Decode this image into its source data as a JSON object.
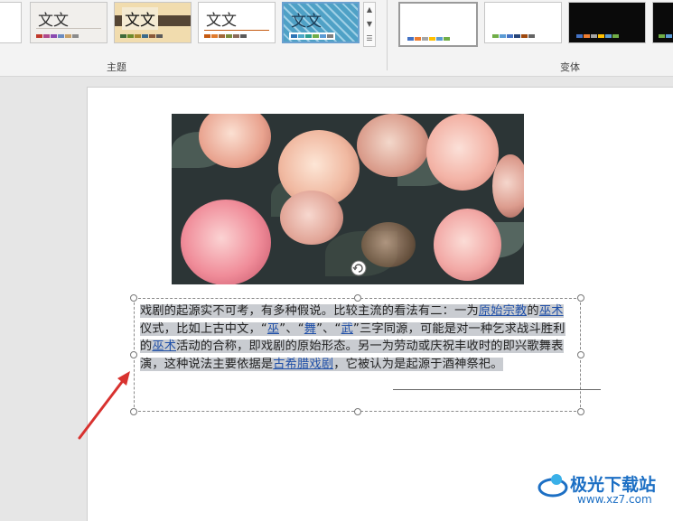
{
  "ribbon": {
    "theme_group_label": "主题",
    "variant_group_label": "变体",
    "themes": [
      {
        "label": "文文",
        "bg": "#f1efec"
      },
      {
        "label": "文文",
        "bg": "#f5e2b5"
      },
      {
        "label": "文文",
        "bg": "#ffffff"
      },
      {
        "label": "文文",
        "bg": "#5aa6c9"
      }
    ],
    "variants": [
      {
        "bg": "#ffffff"
      },
      {
        "bg": "#ffffff"
      },
      {
        "bg": "#0a0a0a"
      },
      {
        "bg": "#0a0a0a"
      }
    ]
  },
  "slide": {
    "paragraph": {
      "p1": "戏剧的起源实不可考，有多种假说。比较主流的看法有二：一为",
      "link1": "原始宗教",
      "p2": "的",
      "link2": "巫术",
      "p3": "仪式，比如上古中文，“",
      "link3": "巫",
      "p4": "”、“",
      "link4": "舞",
      "p5": "”、“",
      "link5": "武",
      "p6": "”三字同源，可能是对一种乞求战斗胜利的",
      "link6": "巫术",
      "p7": "活动的合称，即戏剧的原始形态。另一为劳动或庆祝丰收时的即兴歌舞表演，这种说法主要依据是",
      "link7": "古希腊戏剧",
      "p8": "，它被认为是起源于酒神祭祀。"
    }
  },
  "watermark": {
    "name": "极光下载站",
    "url": "www.xz7.com"
  },
  "colors": {
    "accent": "#1c6fc4",
    "arrow": "#d8322f",
    "link": "#1f4fa8"
  }
}
